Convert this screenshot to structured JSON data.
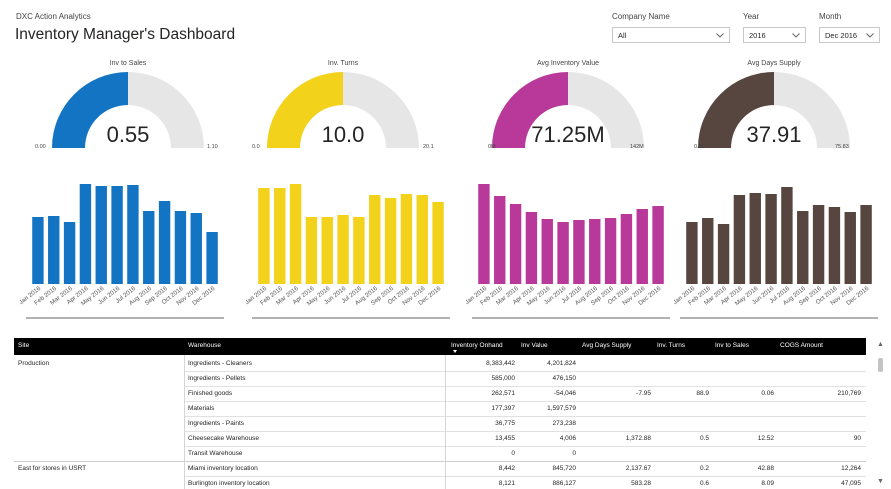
{
  "header": {
    "brand": "DXC Action Analytics",
    "title": "Inventory Manager's Dashboard"
  },
  "slicers": {
    "company": {
      "label": "Company Name",
      "value": "All"
    },
    "year": {
      "label": "Year",
      "value": "2016"
    },
    "month": {
      "label": "Month",
      "value": "Dec 2016"
    }
  },
  "gauges": [
    {
      "title": "Inv to Sales",
      "value": "0.55",
      "min": "0.00",
      "max": "1.10",
      "fraction": 0.5,
      "color": "#1474c4"
    },
    {
      "title": "Inv. Turns",
      "value": "10.0",
      "min": "0.0",
      "max": "20.1",
      "fraction": 0.5,
      "color": "#f2d21a"
    },
    {
      "title": "Avg Inventory Value",
      "value": "71.25M",
      "min": "0M",
      "max": "142M",
      "fraction": 0.5,
      "color": "#b8399a"
    },
    {
      "title": "Avg Days Supply",
      "value": "37.91",
      "min": "0.00",
      "max": "75.83",
      "fraction": 0.5,
      "color": "#574540"
    }
  ],
  "gauge_track_color": "#e6e6e6",
  "chart_data": [
    {
      "type": "bar",
      "color": "#1474c4",
      "ylim": [
        0,
        100
      ],
      "categories": [
        "Jan 2016",
        "Feb 2016",
        "Mar 2016",
        "Apr 2016",
        "May 2016",
        "Jun 2016",
        "Jul 2016",
        "Aug 2016",
        "Sep 2016",
        "Oct 2016",
        "Nov 2016",
        "Dec 2016"
      ],
      "values": [
        67,
        68,
        62,
        100,
        98,
        98,
        99,
        73,
        83,
        73,
        71,
        52
      ]
    },
    {
      "type": "bar",
      "color": "#f2d21a",
      "ylim": [
        0,
        100
      ],
      "categories": [
        "Jan 2016",
        "Feb 2016",
        "Mar 2016",
        "Apr 2016",
        "May 2016",
        "Jun 2016",
        "Jul 2016",
        "Aug 2016",
        "Sep 2016",
        "Oct 2016",
        "Nov 2016",
        "Dec 2016"
      ],
      "values": [
        96,
        96,
        100,
        67,
        67,
        69,
        67,
        89,
        86,
        90,
        89,
        82
      ]
    },
    {
      "type": "bar",
      "color": "#b8399a",
      "ylim": [
        0,
        100
      ],
      "categories": [
        "Jan 2016",
        "Feb 2016",
        "Mar 2016",
        "Apr 2016",
        "May 2016",
        "Jun 2016",
        "Jul 2016",
        "Aug 2016",
        "Sep 2016",
        "Oct 2016",
        "Nov 2016",
        "Dec 2016"
      ],
      "values": [
        100,
        88,
        80,
        72,
        65,
        62,
        64,
        65,
        66,
        70,
        75,
        78
      ]
    },
    {
      "type": "bar",
      "color": "#574540",
      "ylim": [
        0,
        100
      ],
      "categories": [
        "Jan 2016",
        "Feb 2016",
        "Mar 2016",
        "Apr 2016",
        "May 2016",
        "Jun 2016",
        "Jul 2016",
        "Aug 2016",
        "Sep 2016",
        "Oct 2016",
        "Nov 2016",
        "Dec 2016"
      ],
      "values": [
        62,
        66,
        60,
        89,
        91,
        90,
        97,
        73,
        79,
        77,
        72,
        79
      ]
    }
  ],
  "table": {
    "columns": [
      "Site",
      "Warehouse",
      "Inventory Onhand",
      "Inv Value",
      "Avg Days Supply",
      "Inv. Turns",
      "Inv to Sales",
      "COGS Amount"
    ],
    "rows": [
      {
        "site": "Production",
        "warehouse": "Ingredients - Cleaners",
        "onhand": "8,383,442",
        "value": "4,201,824",
        "days": "",
        "turns": "",
        "ratio": "",
        "cogs": ""
      },
      {
        "site": "",
        "warehouse": "Ingredients - Pellets",
        "onhand": "585,000",
        "value": "476,150",
        "days": "",
        "turns": "",
        "ratio": "",
        "cogs": ""
      },
      {
        "site": "",
        "warehouse": "Finished goods",
        "onhand": "262,571",
        "value": "-54,046",
        "days": "-7.95",
        "turns": "88.9",
        "ratio": "0.06",
        "cogs": "210,769"
      },
      {
        "site": "",
        "warehouse": "Materials",
        "onhand": "177,397",
        "value": "1,597,579",
        "days": "",
        "turns": "",
        "ratio": "",
        "cogs": ""
      },
      {
        "site": "",
        "warehouse": "Ingredients - Paints",
        "onhand": "36,775",
        "value": "273,238",
        "days": "",
        "turns": "",
        "ratio": "",
        "cogs": ""
      },
      {
        "site": "",
        "warehouse": "Cheesecake Warehouse",
        "onhand": "13,455",
        "value": "4,006",
        "days": "1,372.88",
        "turns": "0.5",
        "ratio": "12.52",
        "cogs": "90"
      },
      {
        "site": "",
        "warehouse": "Transit Warehouse",
        "onhand": "0",
        "value": "0",
        "days": "",
        "turns": "",
        "ratio": "",
        "cogs": ""
      },
      {
        "site": "East for stores in USRT",
        "warehouse": "Miami inventory location",
        "onhand": "8,442",
        "value": "845,720",
        "days": "2,137.67",
        "turns": "0.2",
        "ratio": "42.88",
        "cogs": "12,264"
      },
      {
        "site": "",
        "warehouse": "Burlington inventory location",
        "onhand": "8,121",
        "value": "886,127",
        "days": "583.28",
        "turns": "0.6",
        "ratio": "8.09",
        "cogs": "47,095"
      }
    ]
  }
}
